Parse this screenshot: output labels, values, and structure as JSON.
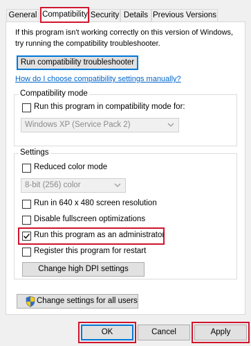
{
  "tabs": [
    {
      "label": "General"
    },
    {
      "label": "Compatibility"
    },
    {
      "label": "Security"
    },
    {
      "label": "Details"
    },
    {
      "label": "Previous Versions"
    }
  ],
  "intro": {
    "line1": "If this program isn't working correctly on this version of Windows,",
    "line2": "try running the compatibility troubleshooter.",
    "troubleshooter_button": "Run compatibility troubleshooter",
    "manual_link": "How do I choose compatibility settings manually?"
  },
  "compat_mode": {
    "title": "Compatibility mode",
    "checkbox_label": "Run this program in compatibility mode for:",
    "checked": false,
    "select_value": "Windows XP (Service Pack 2)"
  },
  "settings": {
    "title": "Settings",
    "reduced_color": {
      "label": "Reduced color mode",
      "checked": false
    },
    "color_select_value": "8-bit (256) color",
    "res640": {
      "label": "Run in 640 x 480 screen resolution",
      "checked": false
    },
    "disable_fullscreen": {
      "label": "Disable fullscreen optimizations",
      "checked": false
    },
    "run_admin": {
      "label": "Run this program as an administrator",
      "checked": true
    },
    "register_restart": {
      "label": "Register this program for restart",
      "checked": false
    },
    "dpi_button": "Change high DPI settings"
  },
  "all_users_button": "Change settings for all users",
  "footer": {
    "ok": "OK",
    "cancel": "Cancel",
    "apply": "Apply"
  },
  "colors": {
    "highlight": "#d0142c",
    "link": "#0066cc",
    "focus": "#0078d7"
  },
  "icons": {
    "shield": "shield-icon",
    "checkmark": "checkmark-icon",
    "dropdown": "chevron-down-icon"
  }
}
